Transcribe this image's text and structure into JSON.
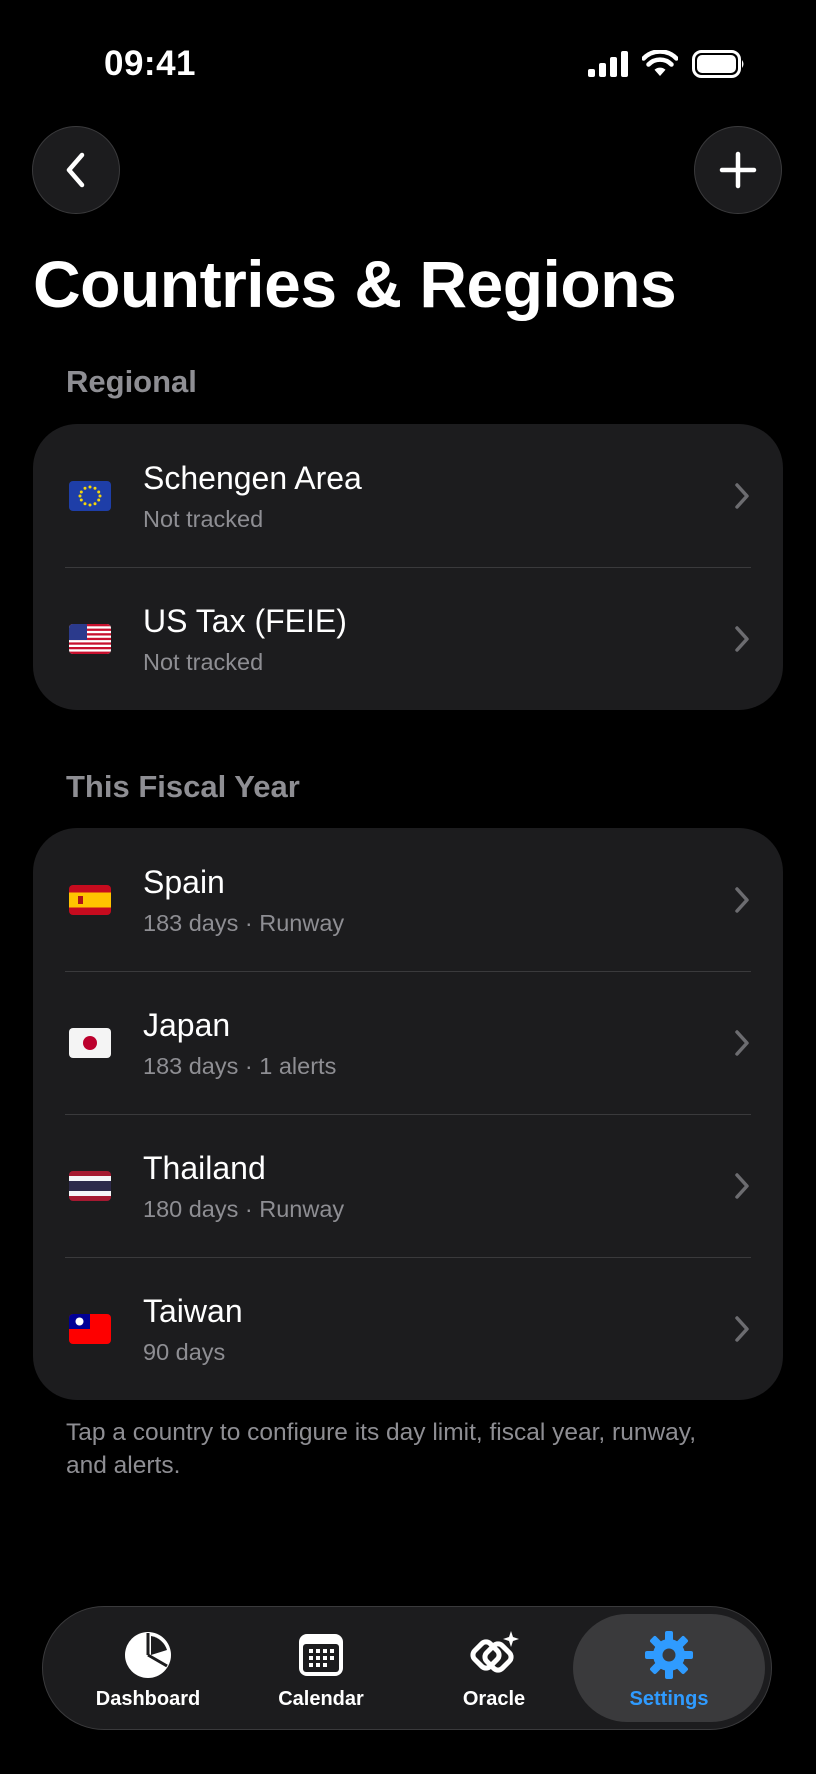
{
  "status_bar": {
    "time": "09:41"
  },
  "header": {
    "title": "Countries & Regions"
  },
  "sections": [
    {
      "header": "Regional",
      "rows": [
        {
          "flag": "eu-flag",
          "title": "Schengen Area",
          "subtitle": "Not tracked"
        },
        {
          "flag": "us-flag",
          "title": "US Tax (FEIE)",
          "subtitle": "Not tracked"
        }
      ]
    },
    {
      "header": "This Fiscal Year",
      "rows": [
        {
          "flag": "spain-flag",
          "title": "Spain",
          "subtitle": "183 days · Runway"
        },
        {
          "flag": "japan-flag",
          "title": "Japan",
          "subtitle": "183 days · 1 alerts"
        },
        {
          "flag": "thailand-flag",
          "title": "Thailand",
          "subtitle": "180 days · Runway"
        },
        {
          "flag": "taiwan-flag",
          "title": "Taiwan",
          "subtitle": "90 days"
        }
      ]
    }
  ],
  "footnote": "Tap a country to configure its day limit, fiscal year, runway, and alerts.",
  "tabs": [
    {
      "label": "Dashboard",
      "icon": "pie-chart-icon"
    },
    {
      "label": "Calendar",
      "icon": "calendar-icon"
    },
    {
      "label": "Oracle",
      "icon": "oracle-sparkle-icon"
    },
    {
      "label": "Settings",
      "icon": "gear-icon",
      "active": true
    }
  ],
  "colors": {
    "accent": "#2f9bff",
    "card": "#1c1c1e",
    "secondary_text": "#8e8e93"
  }
}
